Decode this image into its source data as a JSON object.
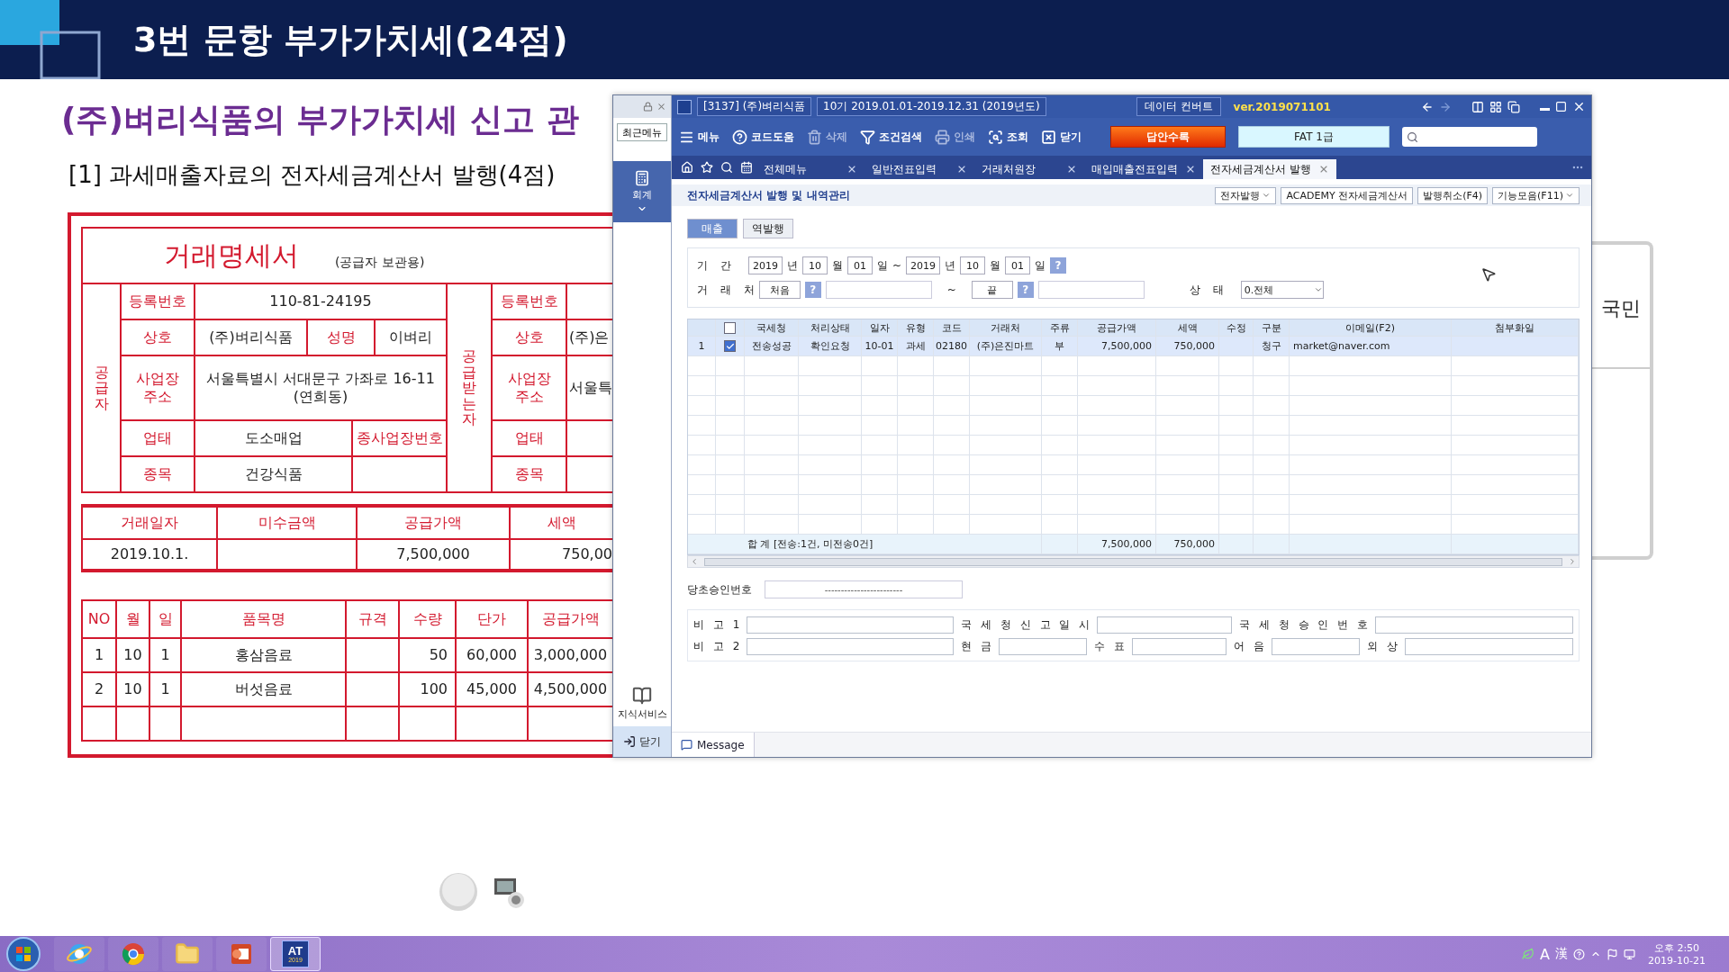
{
  "slide": {
    "title": "3번 문항 부가가치세(24점)",
    "heading": "(주)벼리식품의 부가가치세 신고 관",
    "subheading": "[1] 과세매출자료의 전자세금계산서 발행(4점)"
  },
  "document": {
    "title": "거래명세서",
    "copy_note": "(공급자 보관용)",
    "supplier": {
      "side_label": "공급자",
      "reg_label": "등록번호",
      "reg_no": "110-81-24195",
      "name_label": "상호",
      "name": "(주)벼리식품",
      "rep_label": "성명",
      "rep": "이벼리",
      "address_label": "사업장 주소",
      "address": "서울특별시 서대문구 가좌로 16-11 (연희동)",
      "business_label": "업태",
      "business": "도소매업",
      "branch_label": "종사업장번호",
      "item_label": "종목",
      "item": "건강식품"
    },
    "buyer": {
      "side_label": "공급받는자",
      "reg_label": "등록번호",
      "name_label": "상호",
      "name": "(주)은",
      "address_label": "사업장 주소",
      "address": "서울특",
      "business_label": "업태",
      "item_label": "종목"
    },
    "summary": {
      "columns": [
        "거래일자",
        "미수금액",
        "공급가액",
        "세액"
      ],
      "date": "2019.10.1.",
      "supply_amount": "7,500,000",
      "tax": "750,00"
    },
    "items": {
      "columns": [
        "NO",
        "월",
        "일",
        "품목명",
        "규격",
        "수량",
        "단가",
        "공급가액"
      ],
      "rows": [
        {
          "no": "1",
          "month": "10",
          "day": "1",
          "name": "홍삼음료",
          "qty": "50",
          "price": "60,000",
          "amount": "3,000,000"
        },
        {
          "no": "2",
          "month": "10",
          "day": "1",
          "name": "버섯음료",
          "qty": "100",
          "price": "45,000",
          "amount": "4,500,000"
        }
      ]
    }
  },
  "side_card": {
    "label": "국민"
  },
  "app": {
    "title_bar": {
      "company": "[3137] (주)벼리식품",
      "period": "10기 2019.01.01-2019.12.31 (2019년도)",
      "convert_button": "데이터 컨버트",
      "version": "ver.2019071101"
    },
    "sidebar": {
      "recent_button": "최근메뉴",
      "module": "회계",
      "knowledge": "지식서비스",
      "close": "닫기"
    },
    "toolbar": [
      {
        "label": "메뉴",
        "disabled": false
      },
      {
        "label": "코드도움",
        "disabled": false
      },
      {
        "label": "삭제",
        "disabled": true
      },
      {
        "label": "조건검색",
        "disabled": false
      },
      {
        "label": "인쇄",
        "disabled": true
      },
      {
        "label": "조회",
        "disabled": false
      },
      {
        "label": "닫기",
        "disabled": false
      }
    ],
    "submit_button": "답안수록",
    "level_badge": "FAT 1급",
    "tabs": [
      {
        "label": "전체메뉴",
        "selected": false
      },
      {
        "label": "일반전표입력",
        "selected": false
      },
      {
        "label": "거래처원장",
        "selected": false
      },
      {
        "label": "매입매출전표입력",
        "selected": false
      },
      {
        "label": "전자세금계산서 발행",
        "selected": true
      }
    ],
    "page_title": "전자세금계산서 발행 및 내역관리",
    "actions": [
      {
        "label": "전자발행",
        "dropdown": true
      },
      {
        "label": "ACADEMY 전자세금계산서",
        "dropdown": false
      },
      {
        "label": "발행취소(F4)",
        "dropdown": false
      },
      {
        "label": "기능모음(F11)",
        "dropdown": true
      }
    ],
    "sub_tabs": [
      {
        "label": "매출",
        "selected": true
      },
      {
        "label": "역발행",
        "selected": false
      }
    ],
    "filter": {
      "period_label": "기 간",
      "date_from": [
        {
          "value": "2019",
          "unit": "년"
        },
        {
          "value": "10",
          "unit": "월"
        },
        {
          "value": "01",
          "unit": "일"
        }
      ],
      "period_separator": "~",
      "date_to": [
        {
          "value": "2019",
          "unit": "년"
        },
        {
          "value": "10",
          "unit": "월"
        },
        {
          "value": "01",
          "unit": "일"
        }
      ],
      "date_help": "?",
      "partner_label": "거 래 처",
      "partner_from": "처음",
      "partner_from_help": "?",
      "partner_separator": "~",
      "partner_to": "끝",
      "partner_to_help": "?",
      "status_label": "상 태",
      "status_value": "0.전체"
    },
    "table": {
      "header_checked": false,
      "columns": [
        "국세청",
        "처리상태",
        "일자",
        "유형",
        "코드",
        "거래처",
        "주류",
        "공급가액",
        "세액",
        "수정",
        "구분",
        "이메일(F2)",
        "첨부화일"
      ],
      "rows": [
        {
          "number": "1",
          "checked": true,
          "selected": true,
          "nts_status": "전송성공",
          "process_status": "확인요청",
          "date": "10-01",
          "type": "과세",
          "code": "02180",
          "partner": "(주)은진마트",
          "liquor": "부",
          "supply_amount": "7,500,000",
          "tax": "750,000",
          "category": "청구",
          "email": "market@naver.com"
        }
      ],
      "total": {
        "label": "합 계 [전송:1건, 미전송0건]",
        "supply_amount": "7,500,000",
        "tax": "750,000"
      }
    },
    "approval": {
      "label": "당초승인번호",
      "value": "------------------------"
    },
    "form_rows": [
      [
        "비 고 1",
        "국 세 청 신 고 일 시",
        "국 세 청 승 인 번 호"
      ],
      [
        "비 고 2",
        "현 금",
        "수 표",
        "어 음",
        "외 상"
      ]
    ],
    "message_tab": "Message"
  },
  "taskbar": {
    "apps": [
      {
        "selected": false
      },
      {
        "selected": false
      },
      {
        "selected": false
      },
      {
        "selected": false
      },
      {
        "label": "AT",
        "sublabel": "2019",
        "selected": true
      }
    ],
    "ime_mode": "A",
    "ime_hanja": "漢",
    "time": "오후 2:50",
    "date": "2019-10-21"
  }
}
